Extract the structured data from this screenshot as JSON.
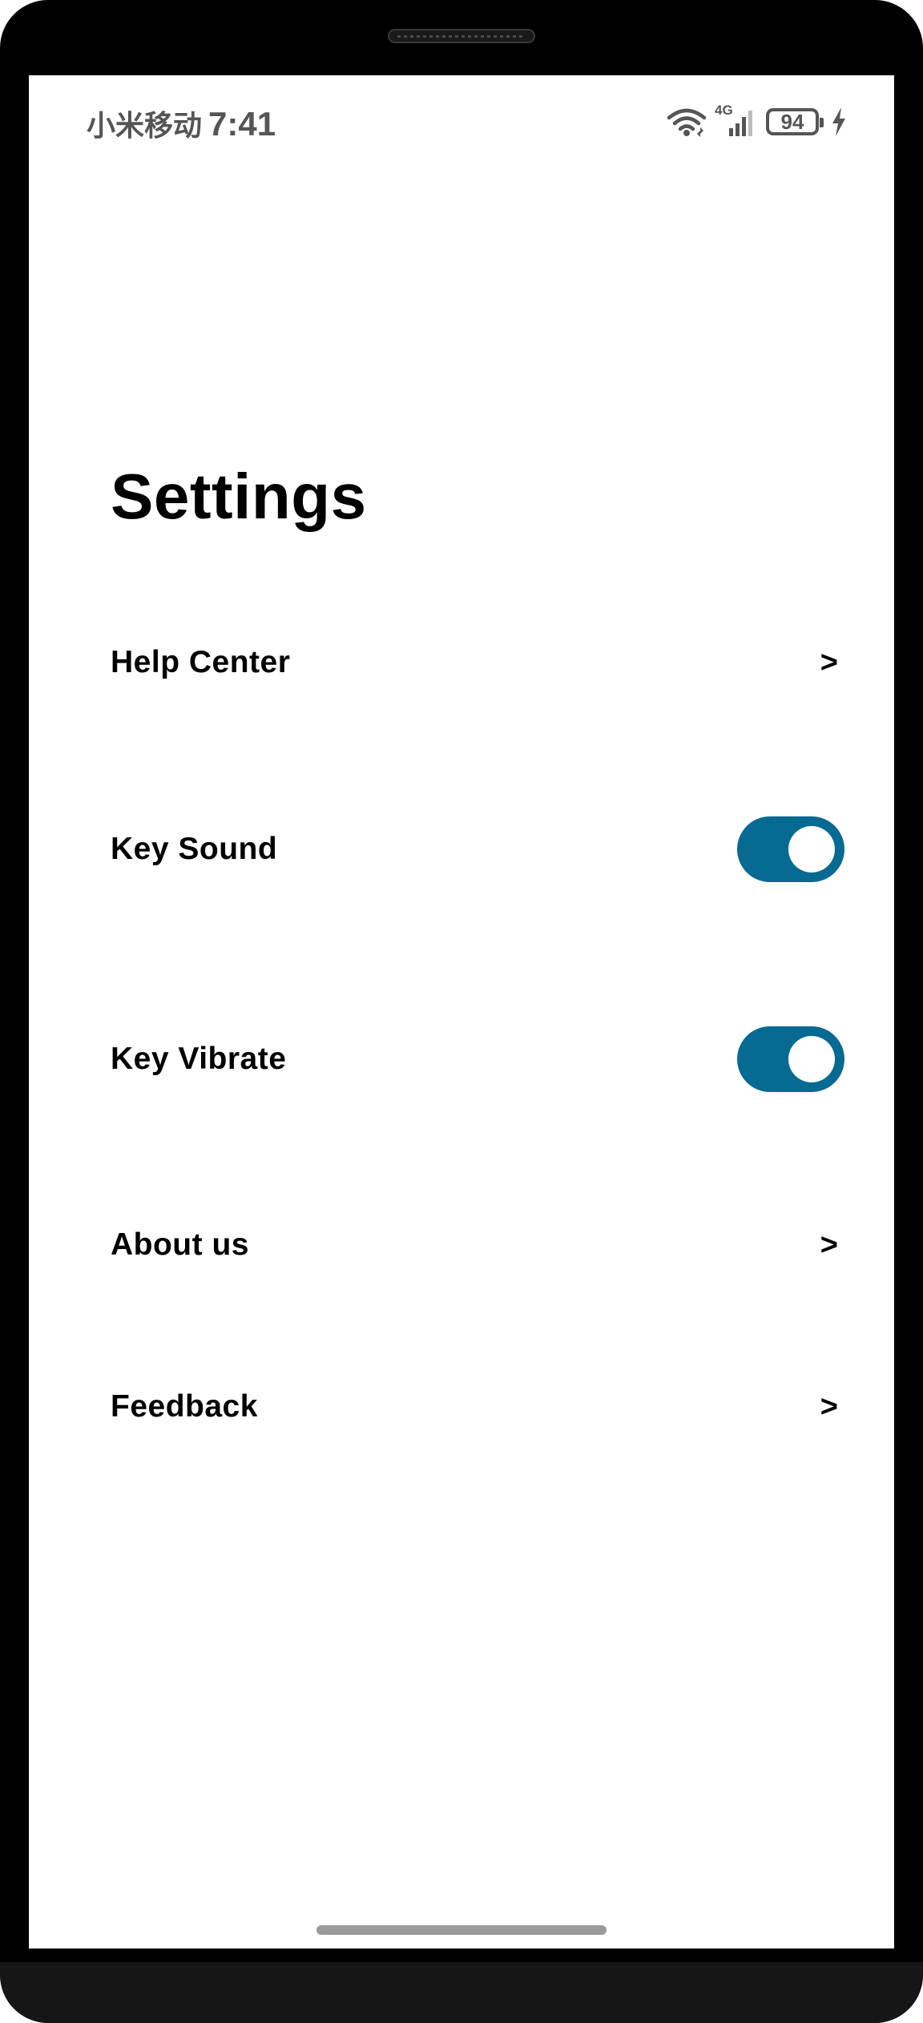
{
  "status_bar": {
    "carrier": "小米移动",
    "time": "7:41",
    "network": "4G",
    "battery_level": "94",
    "wifi_icon": "wifi-icon",
    "signal_icon": "cell-signal-icon",
    "charging_icon": "charging-bolt-icon"
  },
  "page": {
    "title": "Settings"
  },
  "settings": {
    "help_center": {
      "label": "Help Center",
      "chevron": ">"
    },
    "key_sound": {
      "label": "Key Sound",
      "enabled": true
    },
    "key_vibrate": {
      "label": "Key Vibrate",
      "enabled": true
    },
    "about_us": {
      "label": "About us",
      "chevron": ">"
    },
    "feedback": {
      "label": "Feedback",
      "chevron": ">"
    }
  },
  "colors": {
    "toggle_on": "#066a93",
    "text": "#000000",
    "status_text": "#555555"
  }
}
